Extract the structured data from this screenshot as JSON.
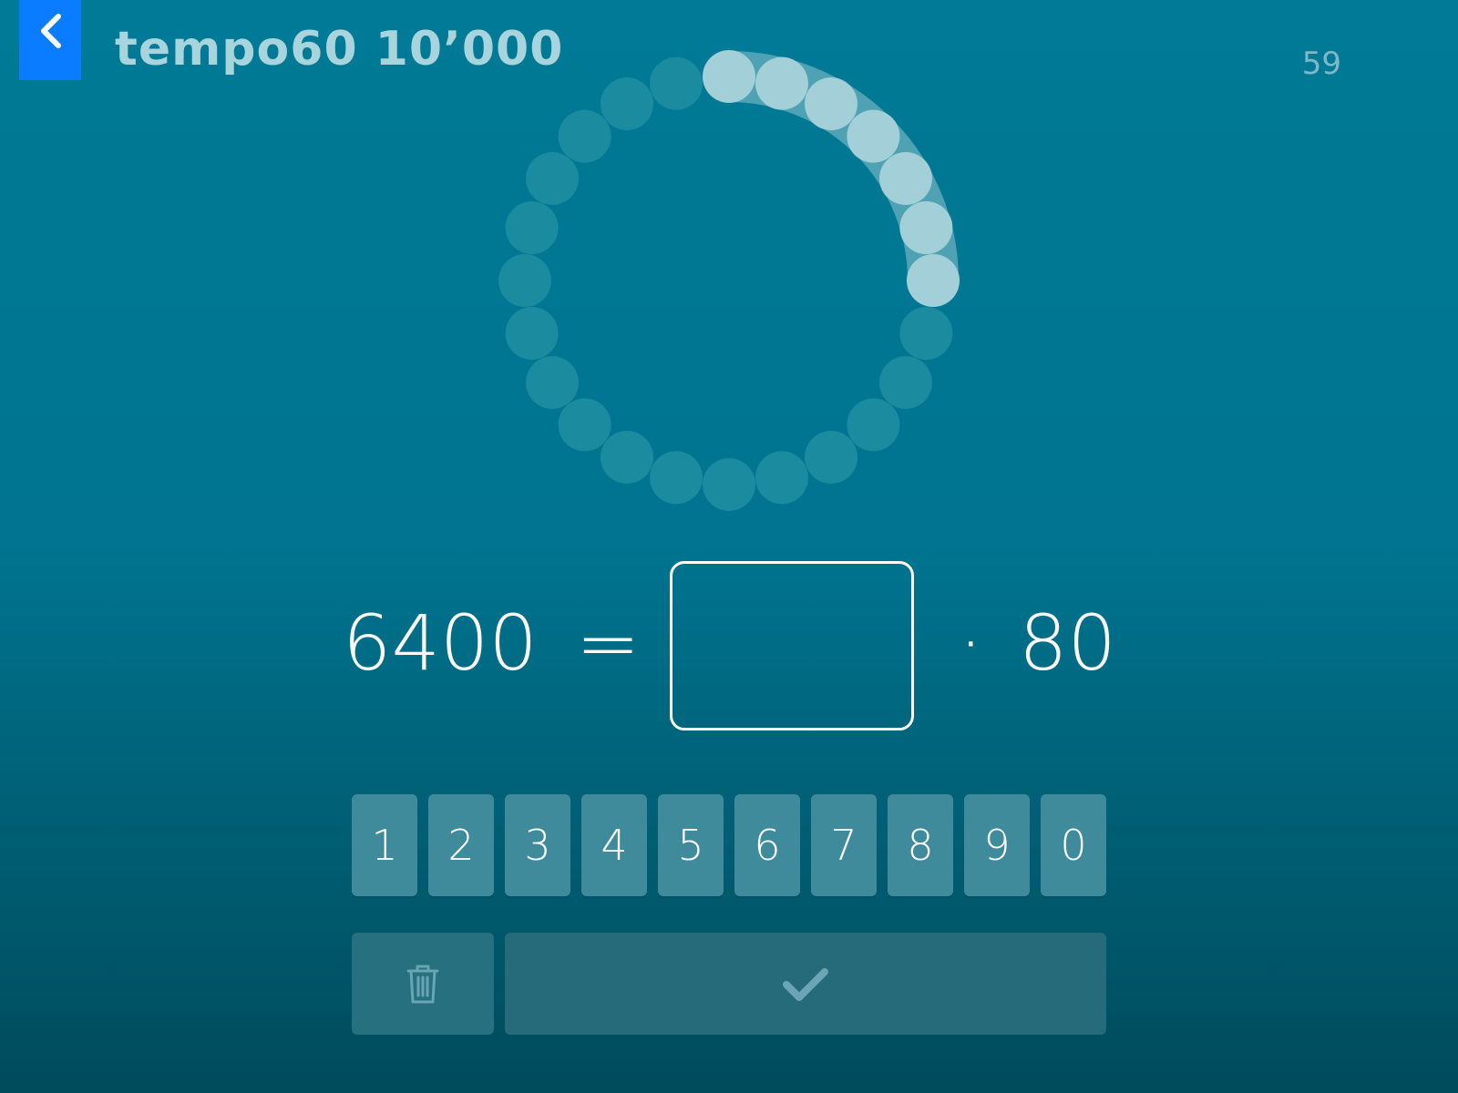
{
  "header": {
    "back_icon": "chevron-left-icon",
    "title": "tempo60 10’000",
    "counter": "59"
  },
  "timer": {
    "total_dots": 24,
    "elapsed_dots": 7
  },
  "equation": {
    "left": "6400",
    "equals": "=",
    "answer": "",
    "operator": "·",
    "right": "80"
  },
  "keypad": {
    "keys": [
      "1",
      "2",
      "3",
      "4",
      "5",
      "6",
      "7",
      "8",
      "9",
      "0"
    ]
  },
  "actions": {
    "delete_icon": "trash-icon",
    "submit_icon": "checkmark-icon"
  },
  "colors": {
    "back_button": "#0a7cff",
    "title": "#a8d4de",
    "dot_active": "#a3cfd8",
    "dot_inactive": "#1b8ba0",
    "key": "#3f8b9b"
  }
}
